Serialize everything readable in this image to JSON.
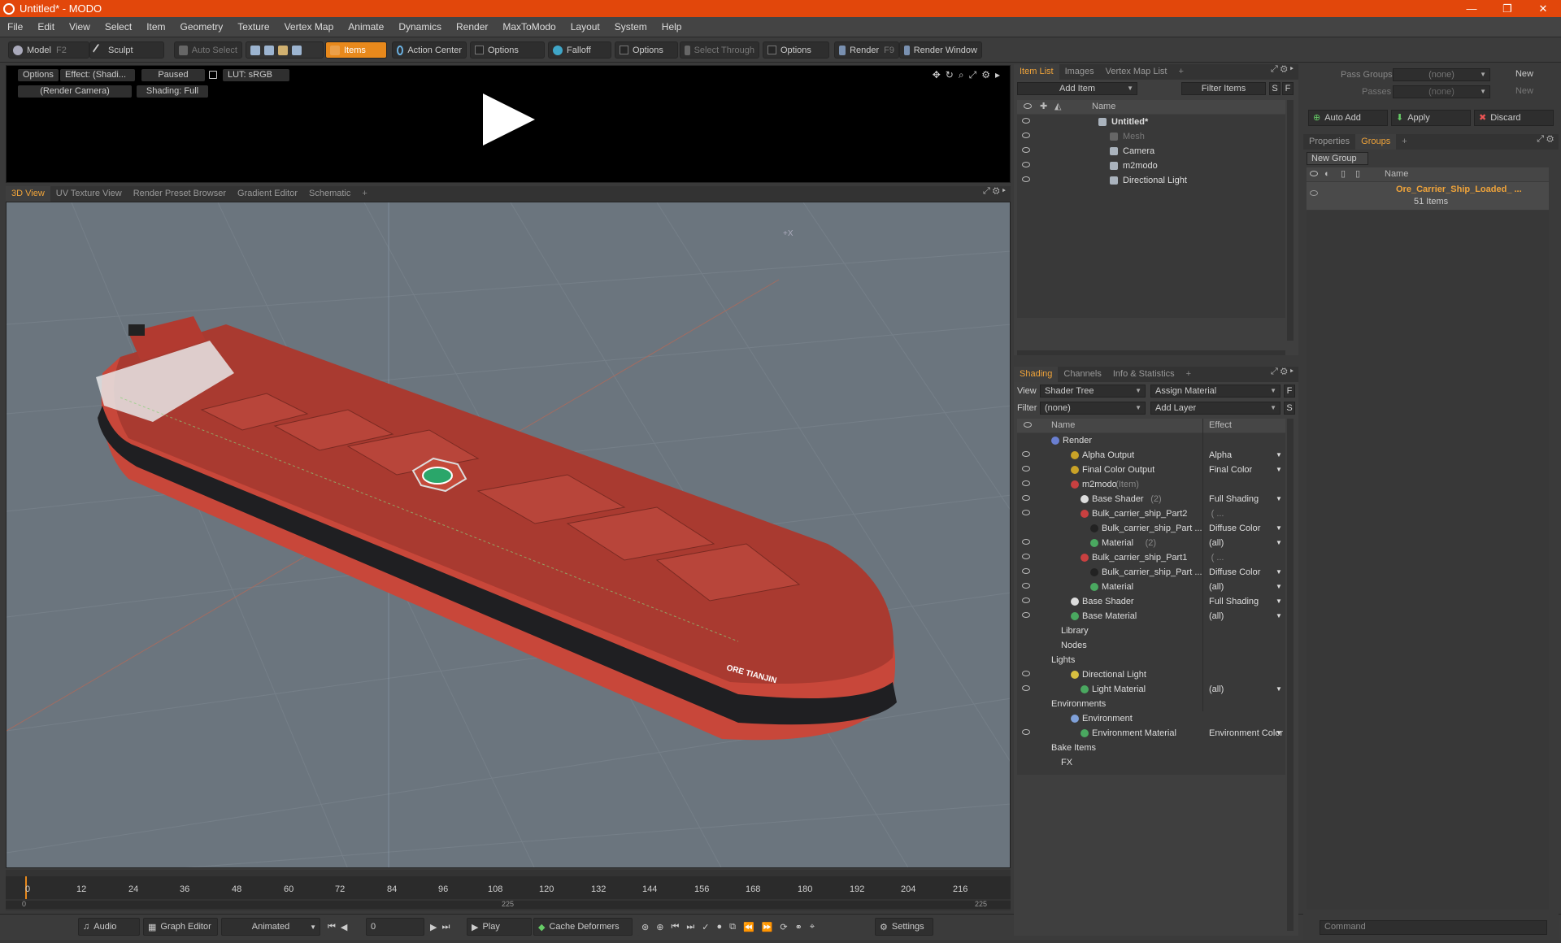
{
  "window": {
    "title": "Untitled* - MODO",
    "controls": [
      "—",
      "❐",
      "✕"
    ]
  },
  "menu": [
    "File",
    "Edit",
    "View",
    "Select",
    "Item",
    "Geometry",
    "Texture",
    "Vertex Map",
    "Animate",
    "Dynamics",
    "Render",
    "MaxToModo",
    "Layout",
    "System",
    "Help"
  ],
  "toolbar": {
    "model": "Model",
    "model_key": "F2",
    "sculpt": "Sculpt",
    "auto_select": "Auto Select",
    "items": "Items",
    "action_center": "Action Center",
    "options1": "Options",
    "falloff": "Falloff",
    "options2": "Options",
    "select_through": "Select Through",
    "options3": "Options",
    "render": "Render",
    "render_key": "F9",
    "render_window": "Render Window"
  },
  "preview": {
    "options": "Options",
    "effect": "Effect: (Shadi...",
    "paused": "Paused",
    "lut": "LUT: sRGB",
    "camera": "(Render Camera)",
    "shading": "Shading: Full"
  },
  "viewtabs": [
    "3D View",
    "UV Texture View",
    "Render Preset Browser",
    "Gradient Editor",
    "Schematic",
    "+"
  ],
  "viewport": {
    "ship_name": "ORE TIANJIN",
    "axis_label": "+X"
  },
  "timeline": {
    "ticks": [
      "0",
      "12",
      "24",
      "36",
      "48",
      "60",
      "72",
      "84",
      "96",
      "108",
      "120",
      "132",
      "144",
      "156",
      "168",
      "180",
      "192",
      "204",
      "216"
    ],
    "range_start": "0",
    "range_mid": "225",
    "range_end": "225"
  },
  "bottom": {
    "audio": "Audio",
    "graph_editor": "Graph Editor",
    "animated": "Animated",
    "frame": "0",
    "play": "Play",
    "cache_deformers": "Cache Deformers",
    "settings": "Settings"
  },
  "itemlist": {
    "tabs": [
      "Item List",
      "Images",
      "Vertex Map List",
      "+"
    ],
    "add_item": "Add Item",
    "filter_items": "Filter Items",
    "s": "S",
    "f": "F",
    "col_name": "Name",
    "rows": [
      {
        "label": "Untitled*",
        "indent": 0,
        "icon": "scene-icon",
        "bold": true
      },
      {
        "label": "Mesh",
        "indent": 1,
        "icon": "mesh-icon",
        "dim": true
      },
      {
        "label": "Camera",
        "indent": 1,
        "icon": "camera-icon"
      },
      {
        "label": "m2modo",
        "indent": 1,
        "icon": "group-icon"
      },
      {
        "label": "Directional Light",
        "indent": 1,
        "icon": "light-icon"
      }
    ]
  },
  "shading": {
    "tabs": [
      "Shading",
      "Channels",
      "Info & Statistics",
      "+"
    ],
    "view_label": "View",
    "view_value": "Shader Tree",
    "assign_material": "Assign Material",
    "filter_label": "Filter",
    "filter_value": "(none)",
    "add_layer": "Add Layer",
    "f": "F",
    "s": "S",
    "col_name": "Name",
    "col_effect": "Effect",
    "rows": [
      {
        "label": "Render",
        "suffix": "",
        "effect": "",
        "indent": 0,
        "color": "#6a7fd1",
        "eye": false
      },
      {
        "label": "Alpha Output",
        "suffix": "",
        "effect": "Alpha",
        "indent": 2,
        "color": "#c9a227",
        "eye": true
      },
      {
        "label": "Final Color Output",
        "suffix": "",
        "effect": "Final Color",
        "indent": 2,
        "color": "#c9a227",
        "eye": true
      },
      {
        "label": "m2modo",
        "suffix": "(Item)",
        "effect": "",
        "indent": 2,
        "color": "#c94040",
        "eye": true
      },
      {
        "label": "Base Shader",
        "suffix": "(2)",
        "effect": "Full Shading",
        "indent": 3,
        "color": "#dddddd",
        "eye": true
      },
      {
        "label": "Bulk_carrier_ship_Part2",
        "suffix": "( ...",
        "effect": "",
        "indent": 3,
        "color": "#c94040",
        "eye": true
      },
      {
        "label": "Bulk_carrier_ship_Part ...",
        "suffix": "",
        "effect": "Diffuse Color",
        "indent": 4,
        "color": "#222222",
        "eye": false
      },
      {
        "label": "Material",
        "suffix": "(2)",
        "effect": "(all)",
        "indent": 4,
        "color": "#4aa860",
        "eye": true
      },
      {
        "label": "Bulk_carrier_ship_Part1",
        "suffix": "( ...",
        "effect": "",
        "indent": 3,
        "color": "#c94040",
        "eye": true
      },
      {
        "label": "Bulk_carrier_ship_Part ...",
        "suffix": "",
        "effect": "Diffuse Color",
        "indent": 4,
        "color": "#222222",
        "eye": true
      },
      {
        "label": "Material",
        "suffix": "",
        "effect": "(all)",
        "indent": 4,
        "color": "#4aa860",
        "eye": true
      },
      {
        "label": "Base Shader",
        "suffix": "",
        "effect": "Full Shading",
        "indent": 2,
        "color": "#dddddd",
        "eye": true
      },
      {
        "label": "Base Material",
        "suffix": "",
        "effect": "(all)",
        "indent": 2,
        "color": "#4aa860",
        "eye": true
      },
      {
        "label": "Library",
        "suffix": "",
        "effect": "",
        "indent": 1,
        "color": "",
        "eye": false
      },
      {
        "label": "Nodes",
        "suffix": "",
        "effect": "",
        "indent": 1,
        "color": "",
        "eye": false
      },
      {
        "label": "Lights",
        "suffix": "",
        "effect": "",
        "indent": 0,
        "color": "",
        "eye": false
      },
      {
        "label": "Directional Light",
        "suffix": "",
        "effect": "",
        "indent": 2,
        "color": "#d8c040",
        "eye": true
      },
      {
        "label": "Light Material",
        "suffix": "",
        "effect": "(all)",
        "indent": 3,
        "color": "#4aa860",
        "eye": true
      },
      {
        "label": "Environments",
        "suffix": "",
        "effect": "",
        "indent": 0,
        "color": "",
        "eye": false
      },
      {
        "label": "Environment",
        "suffix": "",
        "effect": "",
        "indent": 2,
        "color": "#7fa0d8",
        "eye": false
      },
      {
        "label": "Environment Material",
        "suffix": "",
        "effect": "Environment Color",
        "indent": 3,
        "color": "#4aa860",
        "eye": true
      },
      {
        "label": "Bake Items",
        "suffix": "",
        "effect": "",
        "indent": 0,
        "color": "",
        "eye": false
      },
      {
        "label": "FX",
        "suffix": "",
        "effect": "",
        "indent": 1,
        "color": "",
        "eye": false
      }
    ]
  },
  "right": {
    "pass_groups_label": "Pass Groups",
    "pass_groups_value": "(none)",
    "passes_label": "Passes",
    "passes_value": "(none)",
    "new1": "New",
    "new2": "New",
    "auto_add": "Auto Add",
    "apply": "Apply",
    "discard": "Discard",
    "tabs": [
      "Properties",
      "Groups",
      "+"
    ],
    "new_group": "New Group",
    "col_name": "Name",
    "group_name": "Ore_Carrier_Ship_Loaded_ ...",
    "group_count": "51 Items",
    "command": "Command"
  }
}
